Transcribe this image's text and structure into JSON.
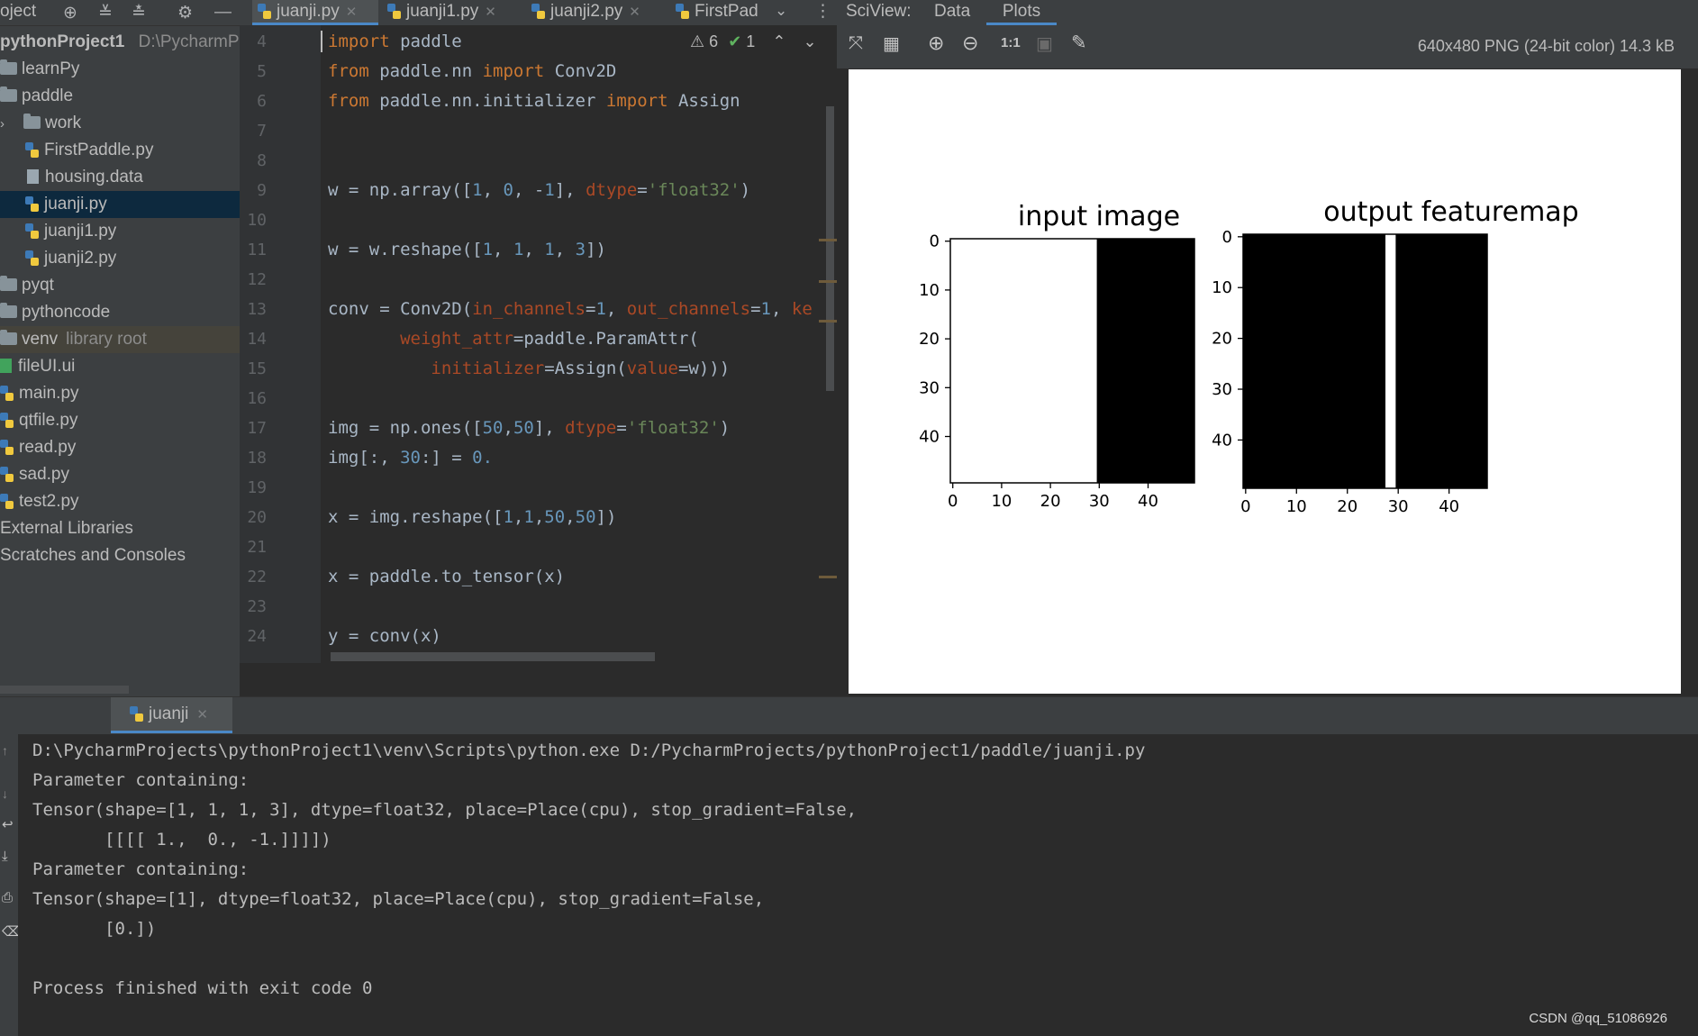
{
  "project": {
    "header_label": "oject",
    "items": [
      {
        "label": "pythonProject1",
        "path": "D:\\PycharmPr",
        "icon": "none"
      },
      {
        "label": "learnPy",
        "icon": "folder-icon"
      },
      {
        "label": "paddle",
        "icon": "folder-icon"
      },
      {
        "label": "work",
        "icon": "folder-icon"
      },
      {
        "label": "FirstPaddle.py",
        "icon": "python-file-icon"
      },
      {
        "label": "housing.data",
        "icon": "text-file-icon"
      },
      {
        "label": "juanji.py",
        "icon": "python-file-icon"
      },
      {
        "label": "juanji1.py",
        "icon": "python-file-icon"
      },
      {
        "label": "juanji2.py",
        "icon": "python-file-icon"
      },
      {
        "label": "pyqt",
        "icon": "folder-icon"
      },
      {
        "label": "pythoncode",
        "icon": "folder-icon"
      },
      {
        "label": "venv",
        "hint": "library root",
        "icon": "folder-icon"
      },
      {
        "label": "fileUI.ui",
        "icon": "qt-ui-file-icon"
      },
      {
        "label": "main.py",
        "icon": "python-file-icon"
      },
      {
        "label": "qtfile.py",
        "icon": "python-file-icon"
      },
      {
        "label": "read.py",
        "icon": "python-file-icon"
      },
      {
        "label": "sad.py",
        "icon": "python-file-icon"
      },
      {
        "label": "test2.py",
        "icon": "python-file-icon"
      },
      {
        "label": "External Libraries",
        "icon": "none"
      },
      {
        "label": "Scratches and Consoles",
        "icon": "none"
      }
    ]
  },
  "editor": {
    "tabs": [
      {
        "label": "juanji.py",
        "active": true
      },
      {
        "label": "juanji1.py",
        "active": false
      },
      {
        "label": "juanji2.py",
        "active": false
      },
      {
        "label": "FirstPad",
        "active": false
      }
    ],
    "inspection": {
      "warnings": "6",
      "ok": "1"
    },
    "line_numbers": [
      "4",
      "5",
      "6",
      "7",
      "8",
      "9",
      "10",
      "11",
      "12",
      "13",
      "14",
      "15",
      "16",
      "17",
      "18",
      "19",
      "20",
      "21",
      "22",
      "23",
      "24"
    ],
    "code_lines": [
      "import paddle",
      "from paddle.nn import Conv2D",
      "from paddle.nn.initializer import Assign",
      "",
      "",
      "w = np.array([1, 0, -1], dtype='float32')",
      "",
      "w = w.reshape([1, 1, 1, 3])",
      "",
      "conv = Conv2D(in_channels=1, out_channels=1, ke",
      "       weight_attr=paddle.ParamAttr(",
      "          initializer=Assign(value=w)))",
      "",
      "img = np.ones([50,50], dtype='float32')",
      "img[:, 30:] = 0.",
      "",
      "x = img.reshape([1,1,50,50])",
      "",
      "x = paddle.to_tensor(x)",
      "",
      "y = conv(x)"
    ]
  },
  "sciview": {
    "title": "SciView:",
    "tabs": [
      {
        "label": "Data",
        "active": false
      },
      {
        "label": "Plots",
        "active": true
      }
    ],
    "image_info": "640x480 PNG (24-bit color) 14.3 kB",
    "toolbar": [
      "fit-icon",
      "grid-icon",
      "zoom-in-icon",
      "zoom-out-icon",
      "actual-size-icon",
      "background-icon",
      "color-picker-icon"
    ]
  },
  "chart_data": [
    {
      "type": "heatmap",
      "title": "input image",
      "xticks": [
        "0",
        "10",
        "20",
        "30",
        "40"
      ],
      "yticks": [
        "0",
        "10",
        "20",
        "30",
        "40"
      ],
      "xlim": [
        0,
        50
      ],
      "ylim": [
        0,
        50
      ],
      "regions": [
        {
          "x": [
            0,
            30
          ],
          "value": 1,
          "color": "#ffffff"
        },
        {
          "x": [
            30,
            50
          ],
          "value": 0,
          "color": "#000000"
        }
      ]
    },
    {
      "type": "heatmap",
      "title": "output featuremap",
      "xticks": [
        "0",
        "10",
        "20",
        "30",
        "40"
      ],
      "yticks": [
        "0",
        "10",
        "20",
        "30",
        "40"
      ],
      "xlim": [
        0,
        48
      ],
      "ylim": [
        0,
        50
      ],
      "regions": [
        {
          "x": [
            0,
            28
          ],
          "value": 0,
          "color": "#000000"
        },
        {
          "x": [
            28,
            30
          ],
          "value": 1,
          "color": "#ffffff"
        },
        {
          "x": [
            30,
            48
          ],
          "value": 0,
          "color": "#000000"
        }
      ]
    }
  ],
  "run": {
    "tab_label": "juanji",
    "console_lines": [
      "D:\\PycharmProjects\\pythonProject1\\venv\\Scripts\\python.exe D:/PycharmProjects/pythonProject1/paddle/juanji.py",
      "Parameter containing:",
      "Tensor(shape=[1, 1, 1, 3], dtype=float32, place=Place(cpu), stop_gradient=False,",
      "       [[[[ 1.,  0., -1.]]]])",
      "Parameter containing:",
      "Tensor(shape=[1], dtype=float32, place=Place(cpu), stop_gradient=False,",
      "       [0.])",
      "",
      "Process finished with exit code 0"
    ]
  },
  "watermark": "CSDN @qq_51086926"
}
